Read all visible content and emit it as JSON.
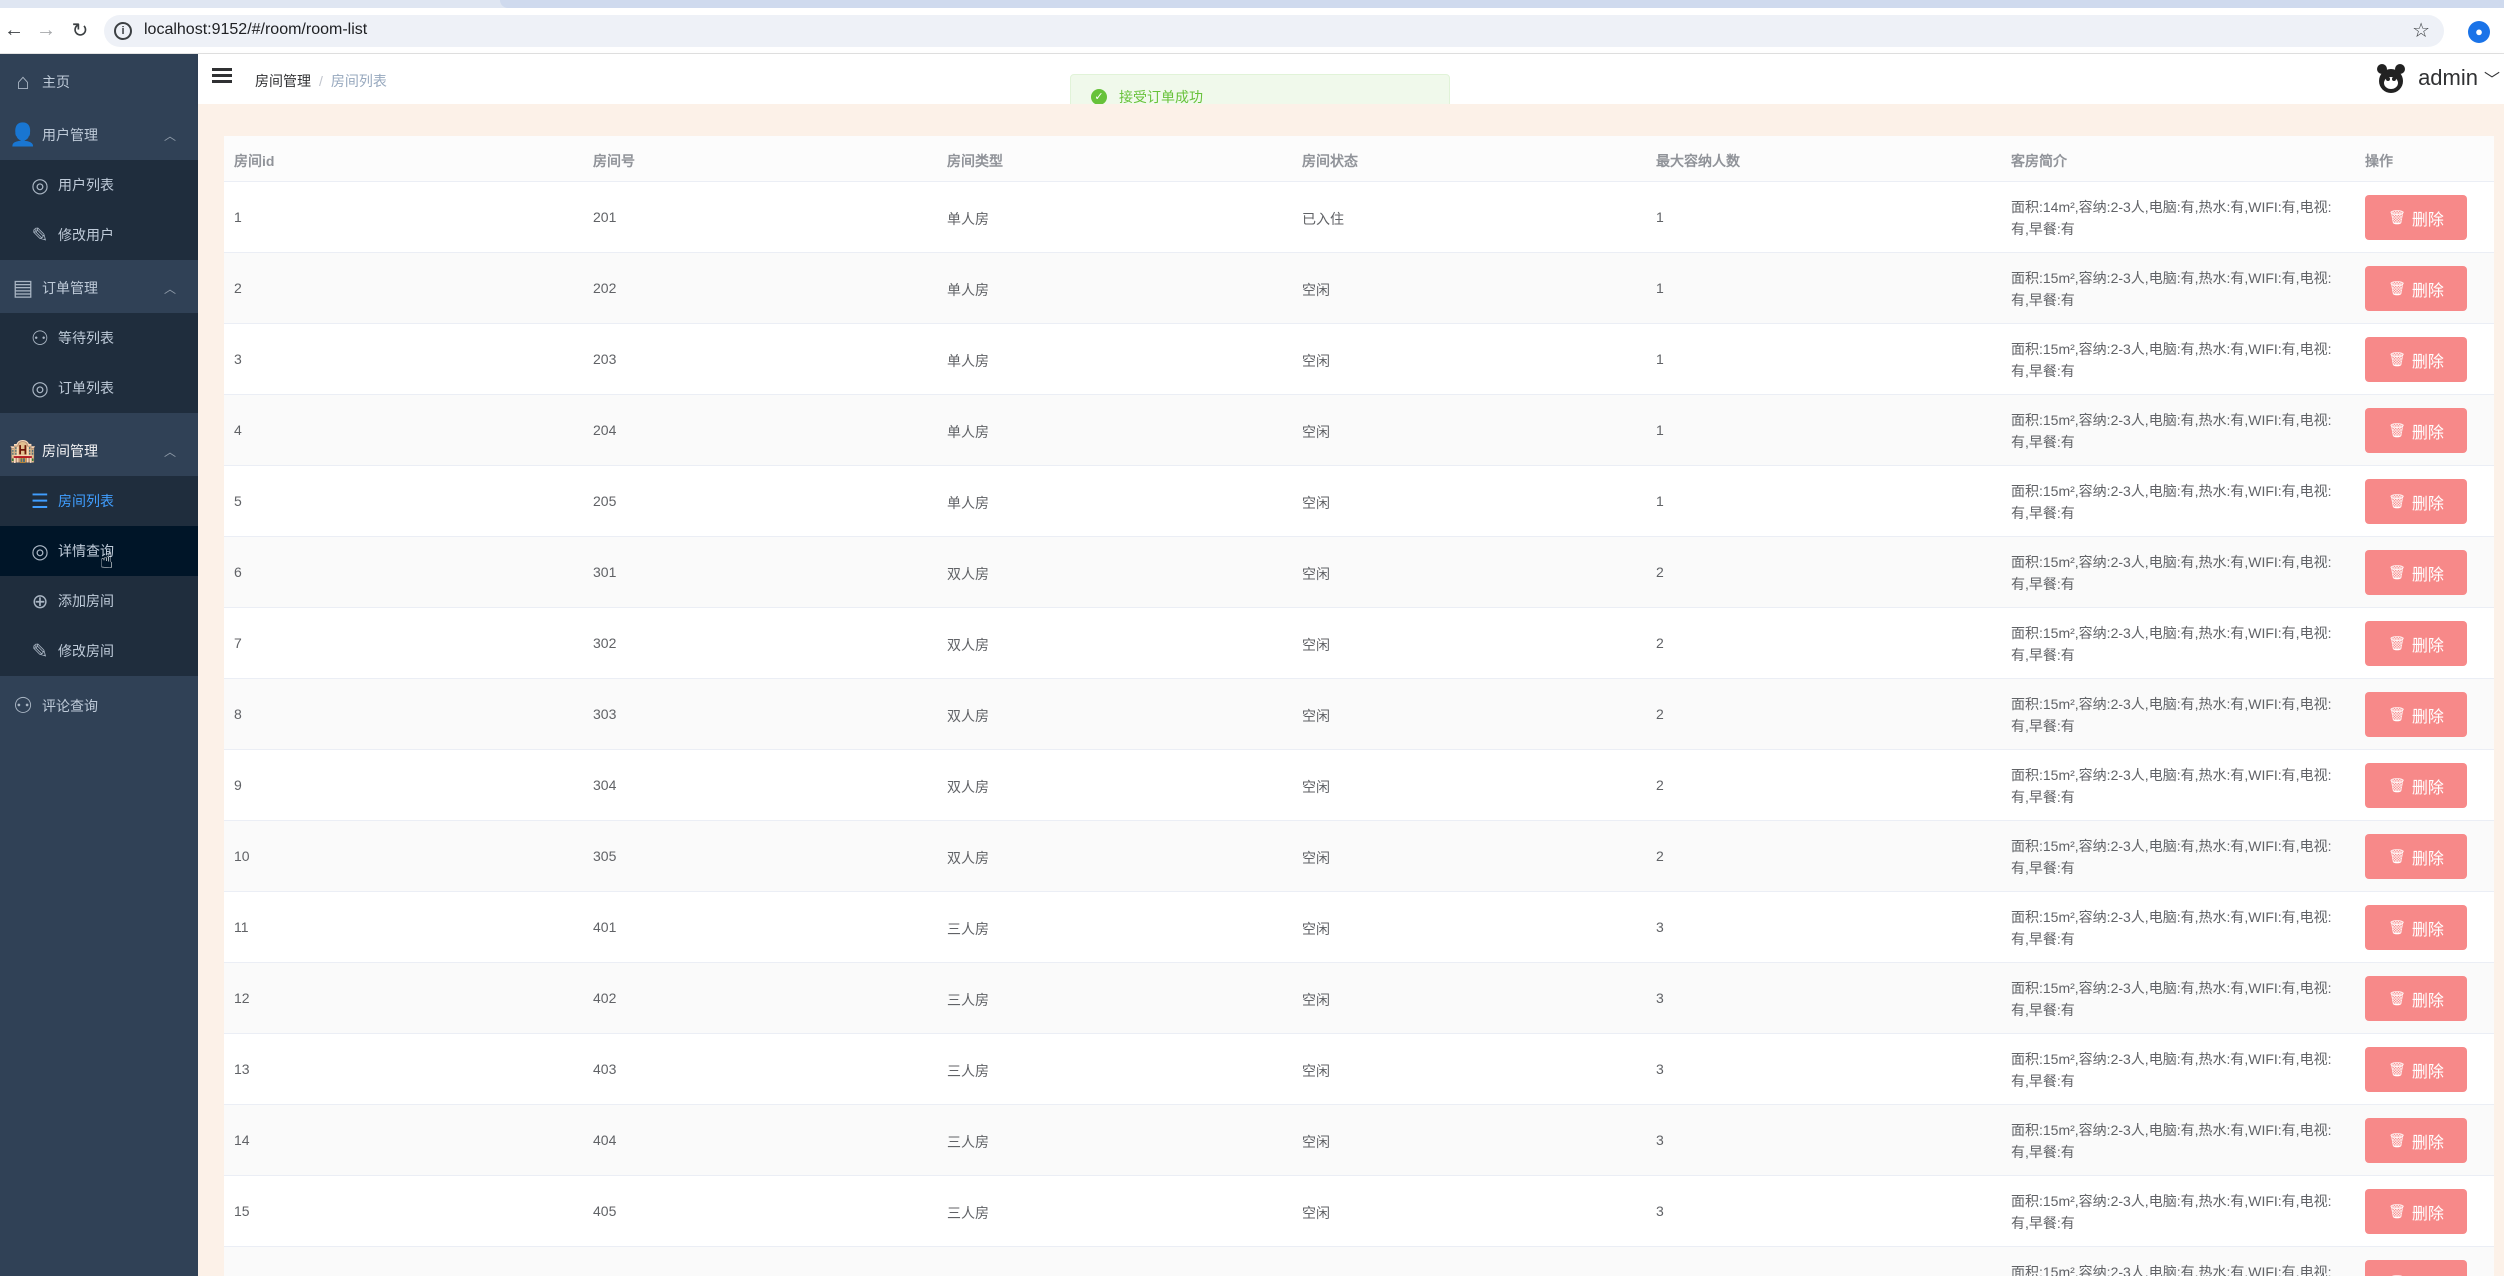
{
  "browser": {
    "url": "localhost:9152/#/room/room-list"
  },
  "sidebar": {
    "home": "主页",
    "groups": [
      {
        "label": "用户管理",
        "items": [
          "用户列表",
          "修改用户"
        ]
      },
      {
        "label": "订单管理",
        "items": [
          "等待列表",
          "订单列表"
        ]
      },
      {
        "label": "房间管理",
        "items": [
          "房间列表",
          "详情查询",
          "添加房间",
          "修改房间"
        ]
      }
    ],
    "comments": "评论查询",
    "active_item": "房间列表"
  },
  "header": {
    "breadcrumb_parent": "房间管理",
    "breadcrumb_current": "房间列表",
    "username": "admin"
  },
  "toast": {
    "message": "接受订单成功",
    "color": "#67c23a"
  },
  "table": {
    "columns": [
      "房间id",
      "房间号",
      "房间类型",
      "房间状态",
      "最大容纳人数",
      "客房简介",
      "操作"
    ],
    "delete_label": "删除",
    "rows": [
      {
        "id": "1",
        "number": "201",
        "type": "单人房",
        "status": "已入住",
        "max": "1",
        "desc": "面积:14m²,容纳:2-3人,电脑:有,热水:有,WIFI:有,电视:有,早餐:有"
      },
      {
        "id": "2",
        "number": "202",
        "type": "单人房",
        "status": "空闲",
        "max": "1",
        "desc": "面积:15m²,容纳:2-3人,电脑:有,热水:有,WIFI:有,电视:有,早餐:有"
      },
      {
        "id": "3",
        "number": "203",
        "type": "单人房",
        "status": "空闲",
        "max": "1",
        "desc": "面积:15m²,容纳:2-3人,电脑:有,热水:有,WIFI:有,电视:有,早餐:有"
      },
      {
        "id": "4",
        "number": "204",
        "type": "单人房",
        "status": "空闲",
        "max": "1",
        "desc": "面积:15m²,容纳:2-3人,电脑:有,热水:有,WIFI:有,电视:有,早餐:有"
      },
      {
        "id": "5",
        "number": "205",
        "type": "单人房",
        "status": "空闲",
        "max": "1",
        "desc": "面积:15m²,容纳:2-3人,电脑:有,热水:有,WIFI:有,电视:有,早餐:有"
      },
      {
        "id": "6",
        "number": "301",
        "type": "双人房",
        "status": "空闲",
        "max": "2",
        "desc": "面积:15m²,容纳:2-3人,电脑:有,热水:有,WIFI:有,电视:有,早餐:有"
      },
      {
        "id": "7",
        "number": "302",
        "type": "双人房",
        "status": "空闲",
        "max": "2",
        "desc": "面积:15m²,容纳:2-3人,电脑:有,热水:有,WIFI:有,电视:有,早餐:有"
      },
      {
        "id": "8",
        "number": "303",
        "type": "双人房",
        "status": "空闲",
        "max": "2",
        "desc": "面积:15m²,容纳:2-3人,电脑:有,热水:有,WIFI:有,电视:有,早餐:有"
      },
      {
        "id": "9",
        "number": "304",
        "type": "双人房",
        "status": "空闲",
        "max": "2",
        "desc": "面积:15m²,容纳:2-3人,电脑:有,热水:有,WIFI:有,电视:有,早餐:有"
      },
      {
        "id": "10",
        "number": "305",
        "type": "双人房",
        "status": "空闲",
        "max": "2",
        "desc": "面积:15m²,容纳:2-3人,电脑:有,热水:有,WIFI:有,电视:有,早餐:有"
      },
      {
        "id": "11",
        "number": "401",
        "type": "三人房",
        "status": "空闲",
        "max": "3",
        "desc": "面积:15m²,容纳:2-3人,电脑:有,热水:有,WIFI:有,电视:有,早餐:有"
      },
      {
        "id": "12",
        "number": "402",
        "type": "三人房",
        "status": "空闲",
        "max": "3",
        "desc": "面积:15m²,容纳:2-3人,电脑:有,热水:有,WIFI:有,电视:有,早餐:有"
      },
      {
        "id": "13",
        "number": "403",
        "type": "三人房",
        "status": "空闲",
        "max": "3",
        "desc": "面积:15m²,容纳:2-3人,电脑:有,热水:有,WIFI:有,电视:有,早餐:有"
      },
      {
        "id": "14",
        "number": "404",
        "type": "三人房",
        "status": "空闲",
        "max": "3",
        "desc": "面积:15m²,容纳:2-3人,电脑:有,热水:有,WIFI:有,电视:有,早餐:有"
      },
      {
        "id": "15",
        "number": "405",
        "type": "三人房",
        "status": "空闲",
        "max": "3",
        "desc": "面积:15m²,容纳:2-3人,电脑:有,热水:有,WIFI:有,电视:有,早餐:有"
      },
      {
        "id": "",
        "number": "",
        "type": "",
        "status": "",
        "max": "",
        "desc": "面积:15m²,容纳:2-3人,电脑:有,热水:有,WIFI:有,电视:"
      }
    ]
  },
  "colors": {
    "sidebar_bg": "#304156",
    "submenu_bg": "#1f2d3d",
    "active": "#409eff",
    "danger": "#f78989",
    "main_bg": "#fcf1e8"
  }
}
